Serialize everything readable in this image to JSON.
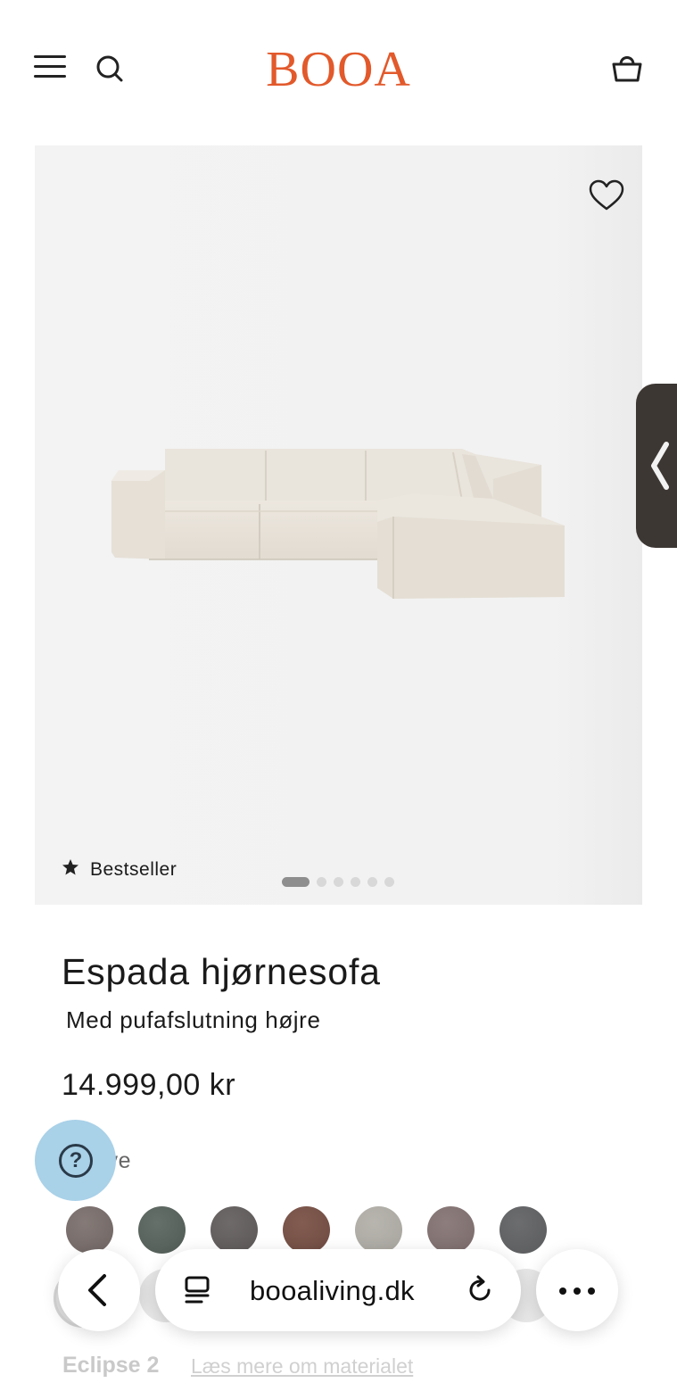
{
  "header": {
    "logo": "BOOA",
    "logo_color": "#e2592b",
    "icons": [
      "menu-icon",
      "search-icon",
      "basket-icon"
    ]
  },
  "gallery": {
    "badge": "Bestseller",
    "badge_icon": "star-icon",
    "wishlist_icon": "heart-icon",
    "slide_count": 6,
    "active_slide": 1
  },
  "product": {
    "title": "Espada hjørnesofa",
    "subtitle": "Med pufafslutning højre",
    "price": "14.999,00 kr",
    "color_label": "t farve"
  },
  "swatches": [
    {
      "color": "#6e6462"
    },
    {
      "color": "#505a54"
    },
    {
      "color": "#5b5656"
    },
    {
      "color": "#6d4a40"
    },
    {
      "color": "#a7a59e"
    },
    {
      "color": "#7a6b6a"
    },
    {
      "color": "#5a5b5d"
    }
  ],
  "material": {
    "name": "Eclipse 2",
    "link": "Læs mere om materialet"
  },
  "browser": {
    "url": "booaliving.dk",
    "icons": [
      "back-chevron-icon",
      "reader-icon",
      "reload-icon",
      "more-icon"
    ]
  },
  "help_icon": "question-icon"
}
